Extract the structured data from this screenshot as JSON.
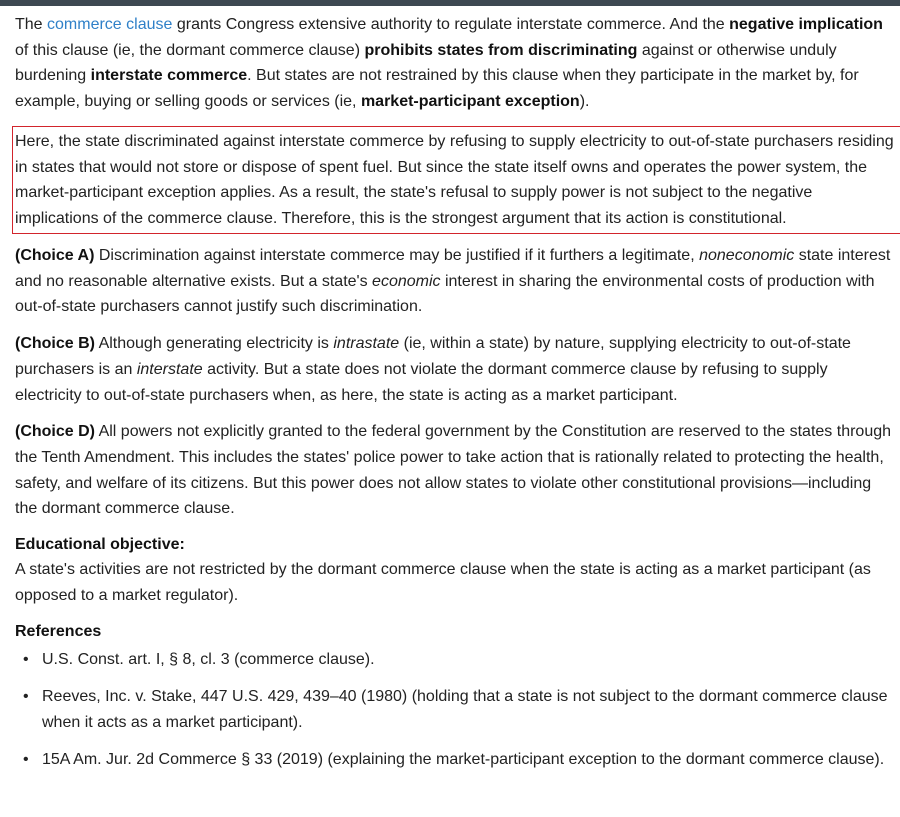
{
  "intro": {
    "t1": "The ",
    "link": "commerce clause",
    "t2": " grants Congress extensive authority to regulate interstate commerce.  And the ",
    "b1": "negative implication",
    "t3": " of this clause (ie, the dormant commerce clause) ",
    "b2": "prohibits states from discriminating",
    "t4": " against or otherwise unduly burdening ",
    "b3": "interstate commerce",
    "t5": ".  But states are not restrained by this clause when they participate in the market by, for example, buying or selling goods or services (ie, ",
    "b4": "market-participant exception",
    "t6": ")."
  },
  "highlight": "Here, the state discriminated against interstate commerce by refusing to supply electricity to out-of-state purchasers residing in states that would not store or dispose of spent fuel.  But since the state itself owns and operates the power system, the market-participant exception applies.  As a result, the state's refusal to supply power is not subject to the negative implications of the commerce clause.  Therefore, this is the strongest argument that its action is constitutional.",
  "choice_a": {
    "label": "(Choice A)",
    "t1": "  Discrimination against interstate commerce may be justified if it furthers a legitimate, ",
    "i1": "noneconomic",
    "t2": " state interest and no reasonable alternative exists.  But a state's ",
    "i2": "economic",
    "t3": " interest in sharing the environmental costs of production with out-of-state purchasers cannot justify such discrimination."
  },
  "choice_b": {
    "label": "(Choice B)",
    "t1": "  Although generating electricity is ",
    "i1": "intrastate",
    "t2": " (ie, within a state) by nature, supplying electricity to out-of-state purchasers is an ",
    "i2": "interstate",
    "t3": " activity.  But a state does not violate the dormant commerce clause by refusing to supply electricity to out-of-state purchasers when, as here, the state is acting as a market participant."
  },
  "choice_d": {
    "label": "(Choice D)",
    "text": "  All powers not explicitly granted to the federal government by the Constitution are reserved to the states through the Tenth Amendment.  This includes the states' police power to take action that is rationally related to protecting the health, safety, and welfare of its citizens.  But this power does not allow states to violate other constitutional provisions—including the dormant commerce clause."
  },
  "objective": {
    "heading": "Educational objective:",
    "text": "A state's activities are not restricted by the dormant commerce clause when the state is acting as a market participant (as opposed to a market regulator)."
  },
  "references": {
    "heading": "References",
    "items": [
      "U.S. Const. art. I, § 8, cl. 3 (commerce clause).",
      "Reeves, Inc. v. Stake, 447 U.S. 429, 439–40 (1980) (holding that a state is not subject to the dormant commerce clause when it acts as a market participant).",
      "15A Am. Jur. 2d Commerce § 33 (2019) (explaining the market-participant exception to the dormant commerce clause)."
    ]
  }
}
